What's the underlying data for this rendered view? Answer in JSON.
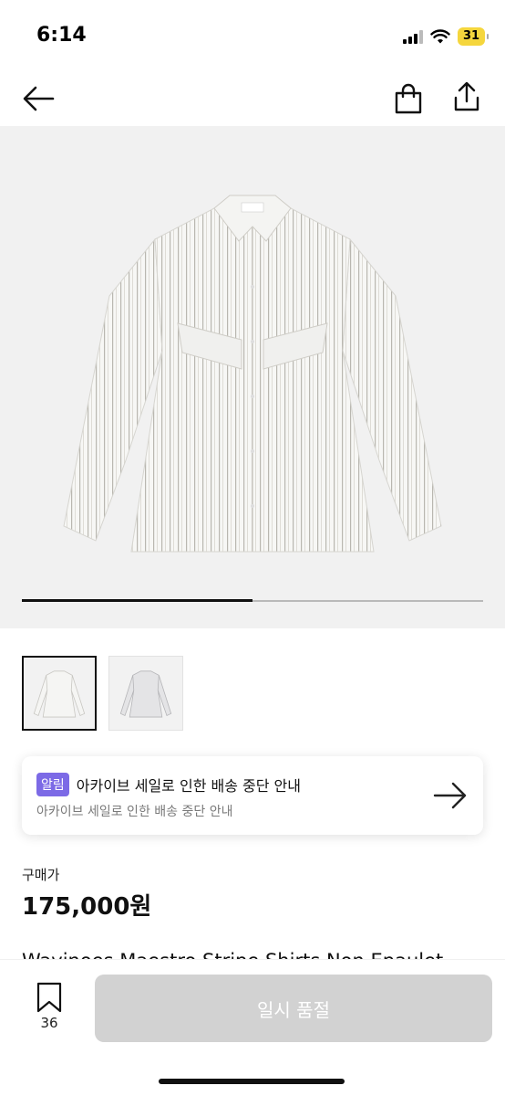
{
  "status": {
    "time": "6:14",
    "battery": "31"
  },
  "gallery": {
    "progress": 0.5
  },
  "notice": {
    "badge": "알림",
    "title": "아카이브 세일로 인한 배송 중단 안내",
    "subtitle": "아카이브 세일로 인한 배송 중단 안내"
  },
  "price": {
    "label": "구매가",
    "value": "175,000원"
  },
  "product": {
    "title": "Wavinoes Maestro Stripe Shirts Non Epaulet"
  },
  "bottom": {
    "wish_count": "36",
    "button_label": "일시 품절"
  },
  "colors": {
    "accent_badge": "#7c6ae6",
    "button_disabled": "#d2d2d2",
    "image_bg": "#f1f1f1"
  },
  "icons": [
    "back-arrow-icon",
    "shopping-bag-icon",
    "share-icon",
    "arrow-right-icon",
    "bookmark-icon"
  ]
}
